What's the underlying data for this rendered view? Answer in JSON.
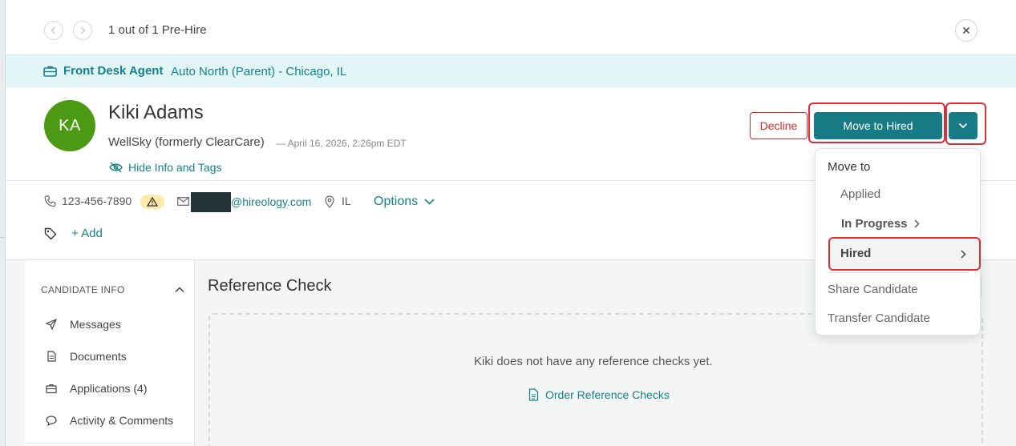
{
  "nav": {
    "counter": "1 out of 1 Pre-Hire"
  },
  "job": {
    "title": "Front Desk Agent",
    "location": "Auto North (Parent) - Chicago, IL"
  },
  "candidate": {
    "initials": "KA",
    "name": "Kiki Adams",
    "company": "WellSky (formerly ClearCare)",
    "date": "— April 16, 2026, 2:26pm EDT",
    "hide_info_label": "Hide Info and Tags",
    "phone": "123-456-7890",
    "email_domain": "@hireology.com",
    "state": "IL",
    "options_label": "Options",
    "add_tag_label": "+ Add"
  },
  "actions": {
    "decline_label": "Decline",
    "move_label": "Move to Hired"
  },
  "menu": {
    "heading": "Move to",
    "applied": "Applied",
    "in_progress": "In Progress",
    "hired": "Hired",
    "share": "Share Candidate",
    "transfer": "Transfer Candidate"
  },
  "sidebar": {
    "heading": "CANDIDATE INFO",
    "items": [
      {
        "label": "Messages",
        "icon": "send-icon"
      },
      {
        "label": "Documents",
        "icon": "document-icon"
      },
      {
        "label": "Applications (4)",
        "icon": "briefcase-icon"
      },
      {
        "label": "Activity & Comments",
        "icon": "comment-icon"
      }
    ]
  },
  "main": {
    "section_title": "Reference Check",
    "empty_message": "Kiki does not have any reference checks yet.",
    "order_label": "Order Reference Checks"
  },
  "colors": {
    "accent": "#177b85",
    "avatar": "#4c9a13",
    "danger": "#c9302c",
    "banner": "#e2f6f8"
  }
}
